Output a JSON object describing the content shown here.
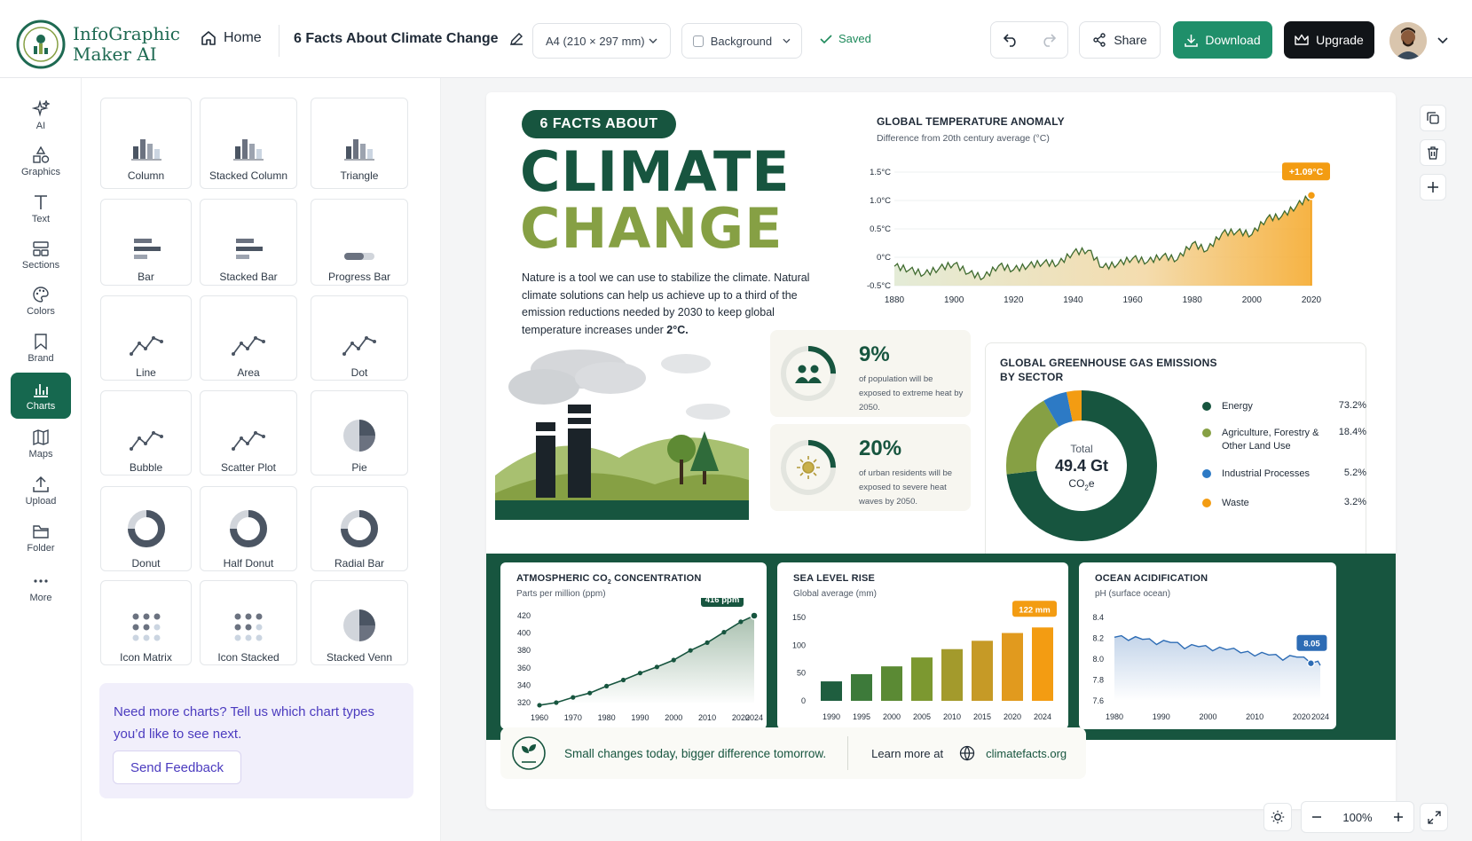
{
  "app": {
    "brand_line1": "InfoGraphic",
    "brand_line2": "Maker AI"
  },
  "topbar": {
    "home_label": "Home",
    "doc_title": "6 Facts About Climate Change",
    "page_size": "A4 (210 × 297 mm)",
    "background_label": "Background",
    "saved_label": "Saved",
    "share_label": "Share",
    "download_label": "Download",
    "upgrade_label": "Upgrade"
  },
  "colors": {
    "brand_green": "#17553f",
    "accent_orange": "#f39c12",
    "olive": "#86a044",
    "blue": "#2d7ac5",
    "upgrade_black": "#111418",
    "download_teal": "#1f8f6a"
  },
  "rail": [
    {
      "label": "AI",
      "icon": "sparkle-icon"
    },
    {
      "label": "Graphics",
      "icon": "shapes-icon"
    },
    {
      "label": "Text",
      "icon": "text-icon"
    },
    {
      "label": "Sections",
      "icon": "sections-icon"
    },
    {
      "label": "Colors",
      "icon": "palette-icon"
    },
    {
      "label": "Brand",
      "icon": "bookmark-icon"
    },
    {
      "label": "Charts",
      "icon": "chart-icon",
      "active": true
    },
    {
      "label": "Maps",
      "icon": "map-icon"
    },
    {
      "label": "Upload",
      "icon": "upload-icon"
    },
    {
      "label": "Folder",
      "icon": "folder-icon"
    },
    {
      "label": "More",
      "icon": "more-icon"
    }
  ],
  "chart_types": [
    {
      "label": "Column",
      "icon": "column"
    },
    {
      "label": "Stacked Column",
      "icon": "column"
    },
    {
      "label": "Triangle",
      "icon": "column"
    },
    {
      "label": "Bar",
      "icon": "bar"
    },
    {
      "label": "Stacked Bar",
      "icon": "bar"
    },
    {
      "label": "Progress Bar",
      "icon": "progress"
    },
    {
      "label": "Line",
      "icon": "line"
    },
    {
      "label": "Area",
      "icon": "line"
    },
    {
      "label": "Dot",
      "icon": "line"
    },
    {
      "label": "Bubble",
      "icon": "line"
    },
    {
      "label": "Scatter Plot",
      "icon": "line"
    },
    {
      "label": "Pie",
      "icon": "pie"
    },
    {
      "label": "Donut",
      "icon": "donut"
    },
    {
      "label": "Half Donut",
      "icon": "donut"
    },
    {
      "label": "Radial Bar",
      "icon": "donut"
    },
    {
      "label": "Icon Matrix",
      "icon": "matrix"
    },
    {
      "label": "Icon Stacked",
      "icon": "matrix"
    },
    {
      "label": "Stacked Venn",
      "icon": "pie"
    }
  ],
  "feedback": {
    "text": "Need more charts? Tell us which chart types you’d like to see next.",
    "button": "Send Feedback"
  },
  "infographic": {
    "tag": "6 FACTS ABOUT",
    "title_line1": "CLIMATE",
    "title_line2": "CHANGE",
    "intro_main": "Nature is a tool we can use to stabilize the climate. Natural climate solutions can help us achieve up to a third of the emission reductions needed by 2030 to keep global temperature increases under ",
    "intro_bold": "2°C.",
    "fact1": {
      "pct": "9%",
      "desc": "of population will be exposed to extreme heat by 2050.",
      "ring": 0.09
    },
    "fact2": {
      "pct": "20%",
      "desc": "of urban residents will be exposed to severe heat waves by 2050.",
      "ring": 0.2
    },
    "footer_slogan": "Small changes today, bigger difference tomorrow.",
    "footer_learn": "Learn more at",
    "footer_url": "climatefacts.org"
  },
  "chart_data": [
    {
      "id": "temp",
      "type": "area",
      "title": "GLOBAL TEMPERATURE ANOMALY",
      "subtitle": "Difference from 20th century average (°C)",
      "x_ticks": [
        "1880",
        "1900",
        "1920",
        "1940",
        "1960",
        "1980",
        "2000",
        "2020"
      ],
      "y_ticks": [
        "1.5°C",
        "1.0°C",
        "0.5°C",
        "0°C",
        "-0.5°C"
      ],
      "xlim": [
        1880,
        2020
      ],
      "ylim": [
        -0.5,
        1.5
      ],
      "x": [
        1880,
        1885,
        1890,
        1895,
        1900,
        1905,
        1910,
        1915,
        1920,
        1925,
        1930,
        1935,
        1940,
        1945,
        1950,
        1955,
        1960,
        1965,
        1970,
        1975,
        1980,
        1985,
        1990,
        1995,
        2000,
        2005,
        2010,
        2015,
        2020
      ],
      "y": [
        -0.16,
        -0.22,
        -0.3,
        -0.2,
        -0.12,
        -0.28,
        -0.36,
        -0.15,
        -0.22,
        -0.15,
        -0.1,
        -0.12,
        0.08,
        0.12,
        -0.18,
        -0.12,
        -0.02,
        -0.08,
        0.02,
        -0.04,
        0.24,
        0.12,
        0.42,
        0.45,
        0.4,
        0.68,
        0.72,
        0.9,
        1.09
      ],
      "annotation": "+1.09°C"
    },
    {
      "id": "ghg",
      "type": "pie",
      "title": "GLOBAL GREENHOUSE GAS EMISSIONS",
      "title2": "BY SECTOR",
      "center_label": "Total",
      "center_value": "49.4 Gt",
      "center_unit": "CO",
      "center_sub": "2",
      "center_suffix": "e",
      "slices": [
        {
          "name": "Energy",
          "value": 73.2,
          "label": "73.2%",
          "color": "#17553f"
        },
        {
          "name": "Agriculture, Forestry & Other Land Use",
          "value": 18.4,
          "label": "18.4%",
          "color": "#86a044"
        },
        {
          "name": "Industrial Processes",
          "value": 5.2,
          "label": "5.2%",
          "color": "#2d7ac5"
        },
        {
          "name": "Waste",
          "value": 3.2,
          "label": "3.2%",
          "color": "#f39c12"
        }
      ]
    },
    {
      "id": "co2",
      "type": "line",
      "title_pre": "ATMOSPHERIC CO",
      "title_sub": "2",
      "title_post": " CONCENTRATION",
      "subtitle": "Parts per million (ppm)",
      "x_ticks": [
        "1960",
        "1970",
        "1980",
        "1990",
        "2000",
        "2010",
        "2020",
        "2024"
      ],
      "y_ticks": [
        "420",
        "400",
        "380",
        "360",
        "340",
        "320"
      ],
      "ylim": [
        320,
        420
      ],
      "x": [
        1960,
        1965,
        1970,
        1975,
        1980,
        1985,
        1990,
        1995,
        2000,
        2005,
        2010,
        2015,
        2020,
        2024
      ],
      "y": [
        317,
        320,
        326,
        331,
        339,
        346,
        354,
        361,
        369,
        380,
        389,
        401,
        413,
        420
      ],
      "annotation": "416 ppm"
    },
    {
      "id": "sea",
      "type": "bar",
      "title": "SEA LEVEL RISE",
      "subtitle": "Global average (mm)",
      "categories": [
        "1990",
        "1995",
        "2000",
        "2005",
        "2010",
        "2015",
        "2020",
        "2024"
      ],
      "values": [
        35,
        48,
        62,
        78,
        93,
        108,
        122,
        132
      ],
      "y_ticks": [
        "150",
        "100",
        "50",
        "0"
      ],
      "ylim": [
        0,
        150
      ],
      "annotation": "122 mm"
    },
    {
      "id": "ocean",
      "type": "line",
      "title": "OCEAN ACIDIFICATION",
      "subtitle": "pH (surface ocean)",
      "x_ticks": [
        "1980",
        "1990",
        "2000",
        "2010",
        "2020",
        "2024"
      ],
      "y_ticks": [
        "8.4",
        "8.2",
        "8.0",
        "7.8",
        "7.6"
      ],
      "ylim": [
        7.6,
        8.4
      ],
      "x": [
        1980,
        1983,
        1986,
        1989,
        1992,
        1995,
        1998,
        2001,
        2004,
        2007,
        2010,
        2013,
        2016,
        2019,
        2022,
        2024
      ],
      "y": [
        8.21,
        8.18,
        8.19,
        8.14,
        8.16,
        8.1,
        8.12,
        8.08,
        8.09,
        8.06,
        8.03,
        8.04,
        7.99,
        8.02,
        7.96,
        7.94
      ],
      "annotation": "8.05"
    }
  ],
  "zoom": {
    "level": "100%"
  }
}
